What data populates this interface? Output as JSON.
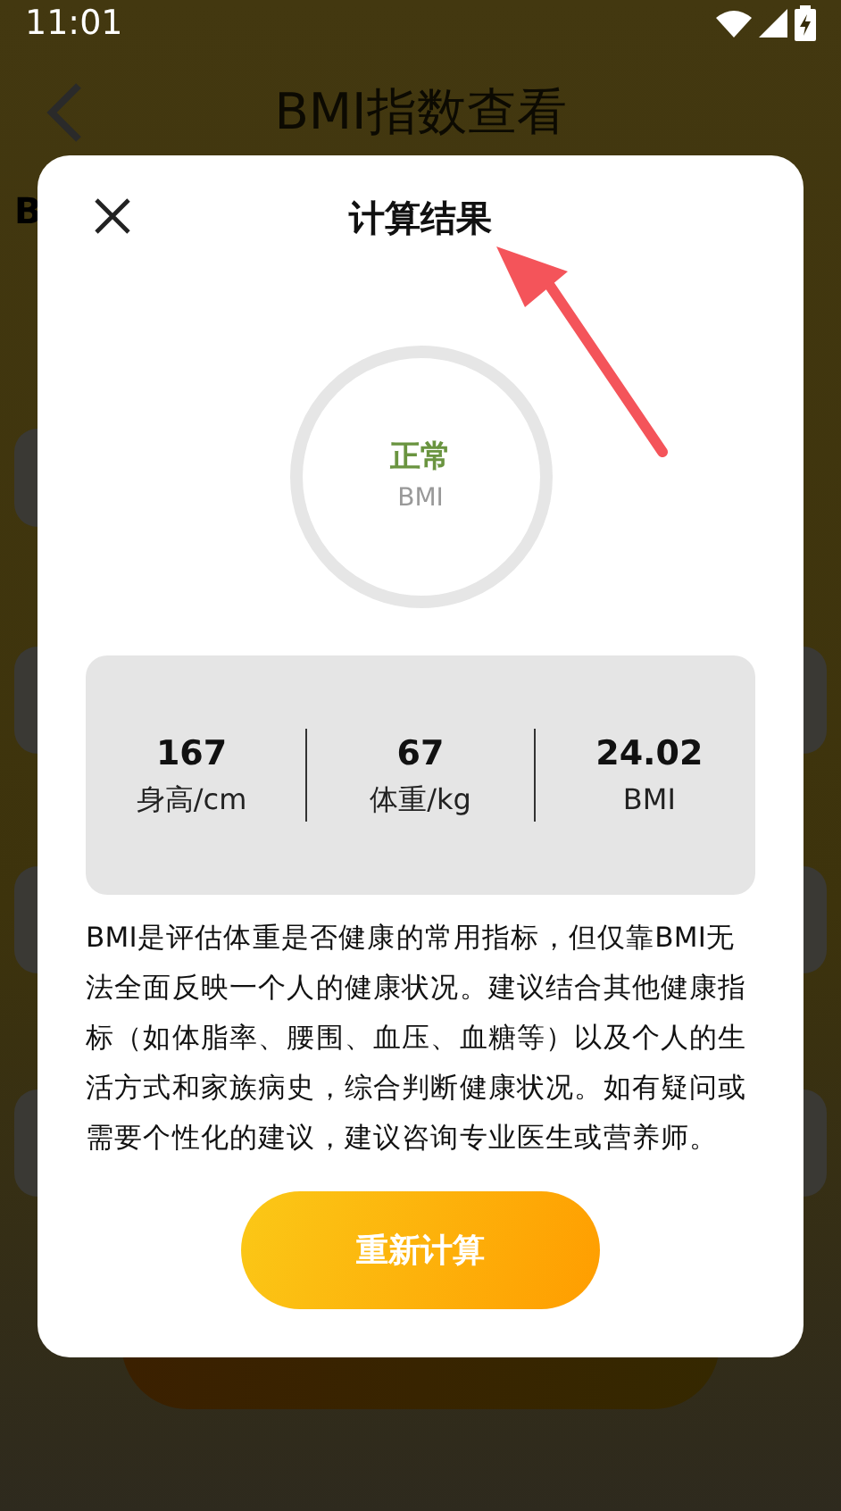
{
  "status_bar": {
    "time": "11:01"
  },
  "header": {
    "title": "BMI指数查看"
  },
  "form": {
    "heading": "B"
  },
  "dialog": {
    "title": "计算结果",
    "result": {
      "status": "正常",
      "unit": "BMI"
    },
    "stats": [
      {
        "value": "167",
        "label": "身高/cm"
      },
      {
        "value": "67",
        "label": "体重/kg"
      },
      {
        "value": "24.02",
        "label": "BMI"
      }
    ],
    "description": "BMI是评估体重是否健康的常用指标，但仅靠BMI无法全面反映一个人的健康状况。建议结合其他健康指标（如体脂率、腰围、血压、血糖等）以及个人的生活方式和家族病史，综合判断健康状况。如有疑问或需要个性化的建议，建议咨询专业医生或营养师。",
    "button": "重新计算"
  }
}
